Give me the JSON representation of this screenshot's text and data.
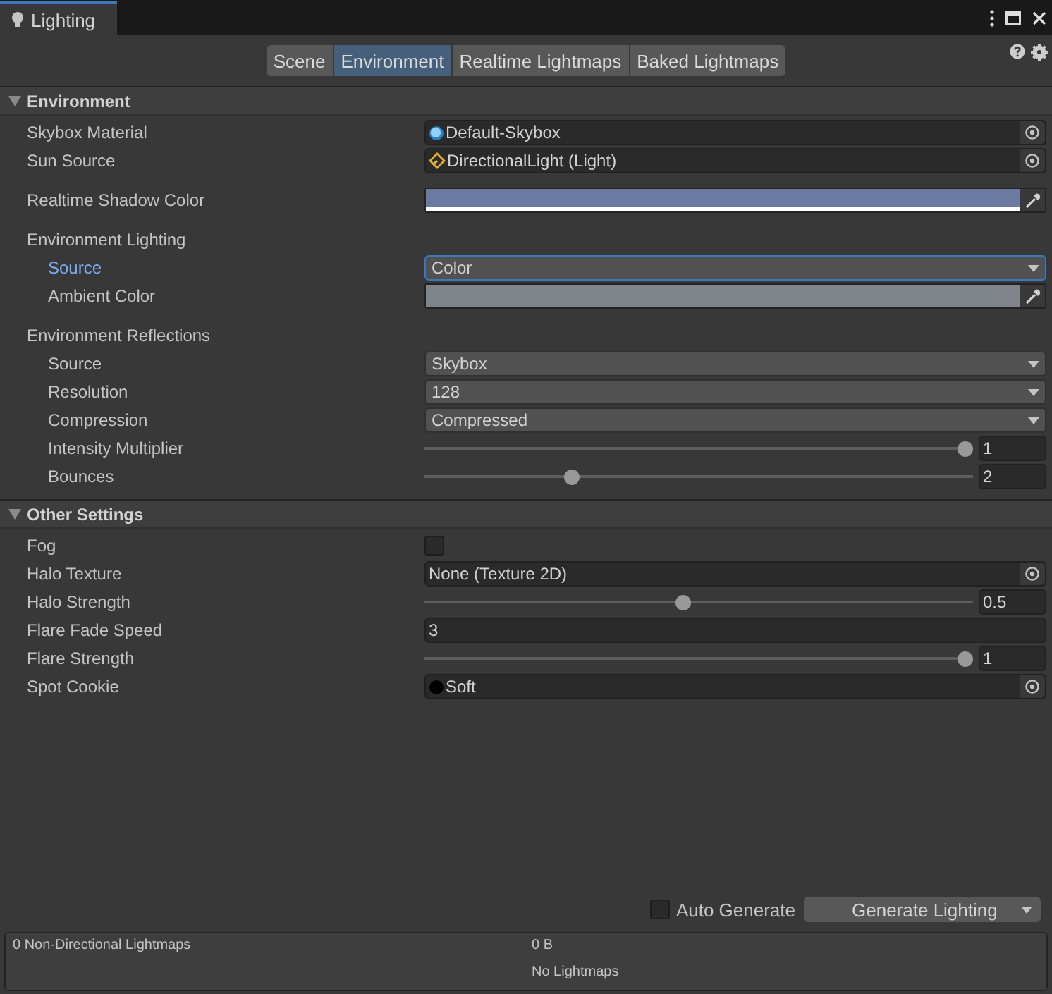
{
  "window": {
    "tab": "Lighting"
  },
  "toolbar_tabs": [
    {
      "label": "Scene",
      "selected": false
    },
    {
      "label": "Environment",
      "selected": true
    },
    {
      "label": "Realtime Lightmaps",
      "selected": false
    },
    {
      "label": "Baked Lightmaps",
      "selected": false
    }
  ],
  "sections": [
    {
      "title": "Environment",
      "expanded": true,
      "rows": [
        {
          "kind": "object",
          "label": "Skybox Material",
          "object": {
            "kind": "material",
            "name": "Default-Skybox"
          }
        },
        {
          "kind": "object",
          "label": "Sun Source",
          "object": {
            "kind": "light",
            "name": "DirectionalLight (Light)"
          }
        },
        {
          "kind": "color",
          "label": "Realtime Shadow Color",
          "color": "#6b7aa1",
          "hdr": false
        },
        {
          "kind": "group",
          "label": "Environment Lighting",
          "children": [
            {
              "kind": "dropdown",
              "label": "Source",
              "value": "Color",
              "focused": true
            },
            {
              "kind": "color",
              "label": "Ambient Color",
              "color": "#7f838a",
              "hdr": true
            }
          ]
        },
        {
          "kind": "group",
          "label": "Environment Reflections",
          "children": [
            {
              "kind": "dropdown",
              "label": "Source",
              "value": "Skybox",
              "focused": false
            },
            {
              "kind": "dropdown",
              "label": "Resolution",
              "value": "128",
              "focused": false
            },
            {
              "kind": "dropdown",
              "label": "Compression",
              "value": "Compressed",
              "focused": false
            },
            {
              "kind": "slider",
              "label": "Intensity Multiplier",
              "level": 1,
              "reading": "1"
            },
            {
              "kind": "slider",
              "label": "Bounces",
              "level": 0.26,
              "reading": "2"
            }
          ]
        }
      ]
    },
    {
      "title": "Other Settings",
      "expanded": true,
      "rows": [
        {
          "kind": "checkbox",
          "label": "Fog",
          "checked": false
        },
        {
          "kind": "object",
          "label": "Halo Texture",
          "object": {
            "kind": "none",
            "name": "None (Texture 2D)"
          }
        },
        {
          "kind": "slider",
          "label": "Halo Strength",
          "level": 0.47,
          "reading": "0.5"
        },
        {
          "kind": "number",
          "label": "Flare Fade Speed",
          "value": "3"
        },
        {
          "kind": "slider",
          "label": "Flare Strength",
          "level": 1,
          "reading": "1"
        },
        {
          "kind": "object",
          "label": "Spot Cookie",
          "object": {
            "kind": "cookie",
            "name": "Soft"
          }
        }
      ]
    }
  ],
  "footer": {
    "auto_generate": {
      "label": "Auto Generate",
      "checked": false
    },
    "generate_button": "Generate Lighting",
    "info": {
      "column_1": [
        "0 Non-Directional Lightmaps"
      ],
      "column_2": [
        "0 B",
        "No Lightmaps"
      ]
    }
  }
}
